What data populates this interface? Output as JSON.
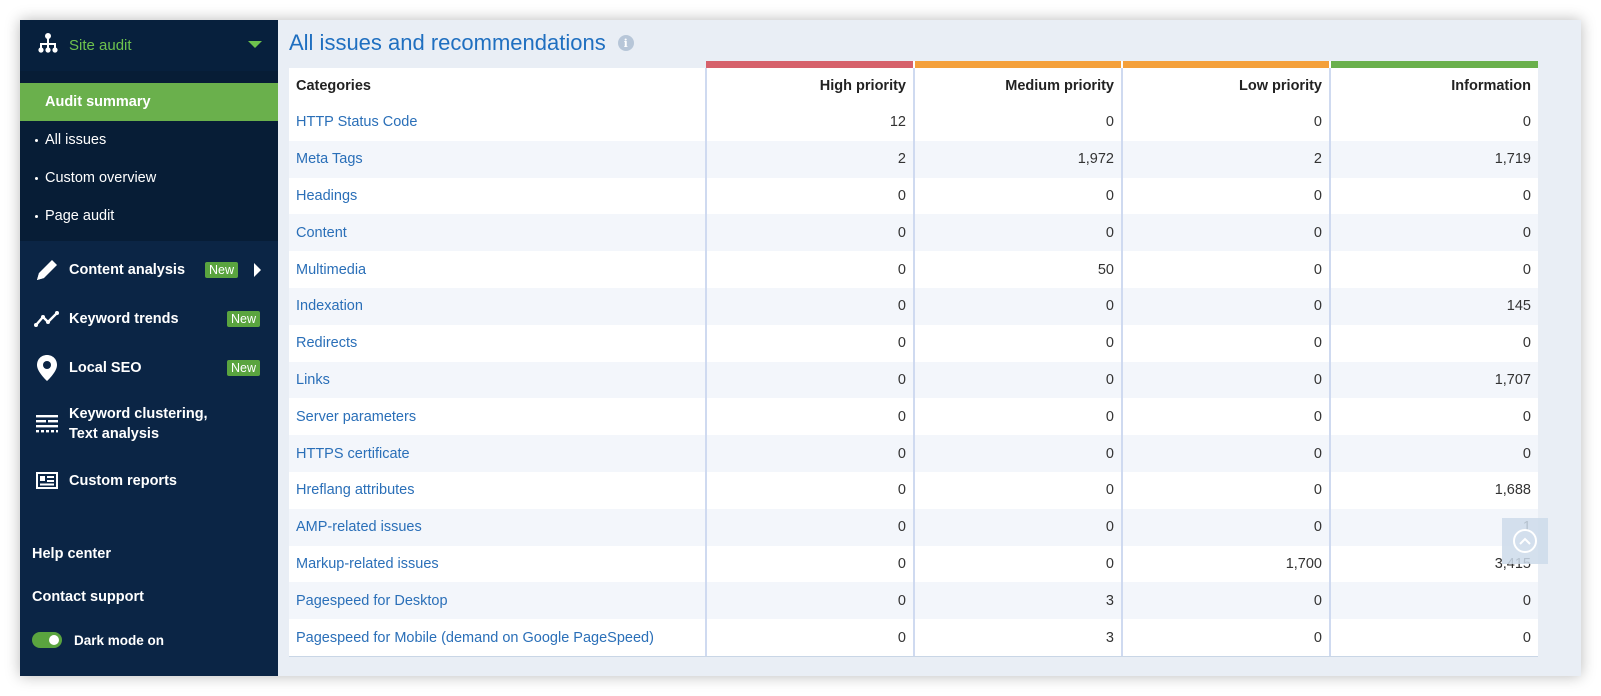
{
  "sidebar": {
    "section_title": "Site audit",
    "sub_items": [
      {
        "label": "Audit summary",
        "active": true
      },
      {
        "label": "All issues",
        "active": false
      },
      {
        "label": "Custom overview",
        "active": false
      },
      {
        "label": "Page audit",
        "active": false
      }
    ],
    "nav": [
      {
        "label": "Content analysis",
        "badge": "New",
        "icon": "pencil-icon"
      },
      {
        "label": "Keyword trends",
        "badge": "New",
        "icon": "trend-line-icon"
      },
      {
        "label": "Local SEO",
        "badge": "New",
        "icon": "map-pin-icon"
      },
      {
        "label": "Keyword clustering, Text analysis",
        "icon": "clustering-icon"
      },
      {
        "label": "Custom reports",
        "icon": "report-icon"
      }
    ],
    "help_center": "Help center",
    "contact_support": "Contact support",
    "dark_mode_label": "Dark mode on",
    "dark_mode_on": true,
    "accent_color": "#6ab04c",
    "background_color": "#0b2545"
  },
  "main": {
    "title": "All issues and recommendations",
    "table": {
      "headers": [
        "Categories",
        "High priority",
        "Medium priority",
        "Low priority",
        "Information"
      ],
      "header_colors": {
        "high": "#d6616b",
        "medium": "#f4a03b",
        "low": "#f4a03b",
        "information": "#6ab04c"
      },
      "rows": [
        [
          "HTTP Status Code",
          "12",
          "0",
          "0",
          "0"
        ],
        [
          "Meta Tags",
          "2",
          "1,972",
          "2",
          "1,719"
        ],
        [
          "Headings",
          "0",
          "0",
          "0",
          "0"
        ],
        [
          "Content",
          "0",
          "0",
          "0",
          "0"
        ],
        [
          "Multimedia",
          "0",
          "50",
          "0",
          "0"
        ],
        [
          "Indexation",
          "0",
          "0",
          "0",
          "145"
        ],
        [
          "Redirects",
          "0",
          "0",
          "0",
          "0"
        ],
        [
          "Links",
          "0",
          "0",
          "0",
          "1,707"
        ],
        [
          "Server parameters",
          "0",
          "0",
          "0",
          "0"
        ],
        [
          "HTTPS certificate",
          "0",
          "0",
          "0",
          "0"
        ],
        [
          "Hreflang attributes",
          "0",
          "0",
          "0",
          "1,688"
        ],
        [
          "AMP-related issues",
          "0",
          "0",
          "0",
          "1"
        ],
        [
          "Markup-related issues",
          "0",
          "0",
          "1,700",
          "3,415"
        ],
        [
          "Pagespeed for Desktop",
          "0",
          "3",
          "0",
          "0"
        ],
        [
          "Pagespeed for Mobile (demand on Google PageSpeed)",
          "0",
          "3",
          "0",
          "0"
        ]
      ]
    }
  }
}
